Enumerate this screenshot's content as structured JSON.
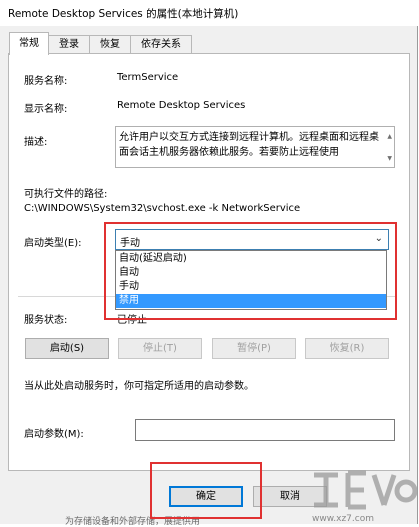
{
  "window": {
    "title": "Remote Desktop Services 的属性(本地计算机)"
  },
  "tabs": [
    {
      "label": "常规",
      "active": true
    },
    {
      "label": "登录",
      "active": false
    },
    {
      "label": "恢复",
      "active": false
    },
    {
      "label": "依存关系",
      "active": false
    }
  ],
  "general": {
    "service_name_label": "服务名称:",
    "service_name_value": "TermService",
    "display_name_label": "显示名称:",
    "display_name_value": "Remote Desktop Services",
    "description_label": "描述:",
    "description_value": "允许用户以交互方式连接到远程计算机。远程桌面和远程桌面会话主机服务器依赖此服务。若要防止远程使用",
    "exe_path_label": "可执行文件的路径:",
    "exe_path_value": "C:\\WINDOWS\\System32\\svchost.exe -k NetworkService",
    "startup_type_label": "启动类型(E):",
    "startup_type_value": "手动",
    "startup_options": [
      "自动(延迟启动)",
      "自动",
      "手动",
      "禁用"
    ],
    "startup_selected_option": "禁用",
    "service_status_label": "服务状态:",
    "service_status_value": "已停止",
    "start_button": "启动(S)",
    "stop_button": "停止(T)",
    "pause_button": "暂停(P)",
    "resume_button": "恢复(R)",
    "start_hint": "当从此处启动服务时，你可指定所适用的启动参数。",
    "start_params_label": "启动参数(M):",
    "start_params_value": ""
  },
  "footer": {
    "ok_button": "确定",
    "cancel_button": "取消"
  },
  "background": {
    "cut_text_left": "为存储设备和外部存储，展提供用",
    "cut_text_right": "www.xz7.com"
  },
  "highlight_color": "#e03131",
  "accent_color": "#0078d7"
}
